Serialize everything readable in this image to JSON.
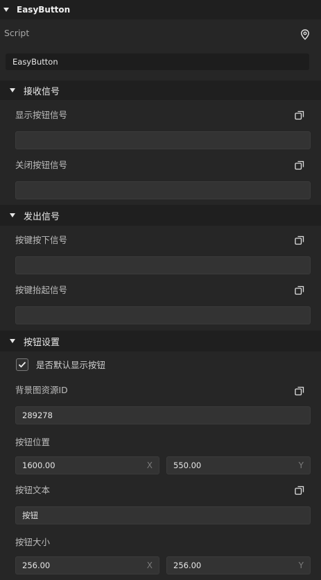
{
  "component": {
    "title": "EasyButton"
  },
  "script": {
    "label": "Script",
    "value": "EasyButton"
  },
  "receive": {
    "title": "接收信号",
    "show_label": "显示按钮信号",
    "show_value": "",
    "close_label": "关闭按钮信号",
    "close_value": ""
  },
  "send": {
    "title": "发出信号",
    "press_label": "按键按下信号",
    "press_value": "",
    "release_label": "按键抬起信号",
    "release_value": ""
  },
  "settings": {
    "title": "按钮设置",
    "default_show_label": "是否默认显示按钮",
    "default_show_checked": true,
    "bg_id_label": "背景图资源ID",
    "bg_id_value": "289278",
    "position_label": "按钮位置",
    "position_x": "1600.00",
    "position_y": "550.00",
    "text_label": "按钮文本",
    "text_value": "按钮",
    "size_label": "按钮大小",
    "size_x": "256.00",
    "size_y": "256.00",
    "axis_x": "X",
    "axis_y": "Y"
  },
  "icons": {
    "collapse": "triangle-down-icon",
    "locate": "location-pin-icon",
    "copy": "copy-icon",
    "check": "checkmark-icon"
  }
}
